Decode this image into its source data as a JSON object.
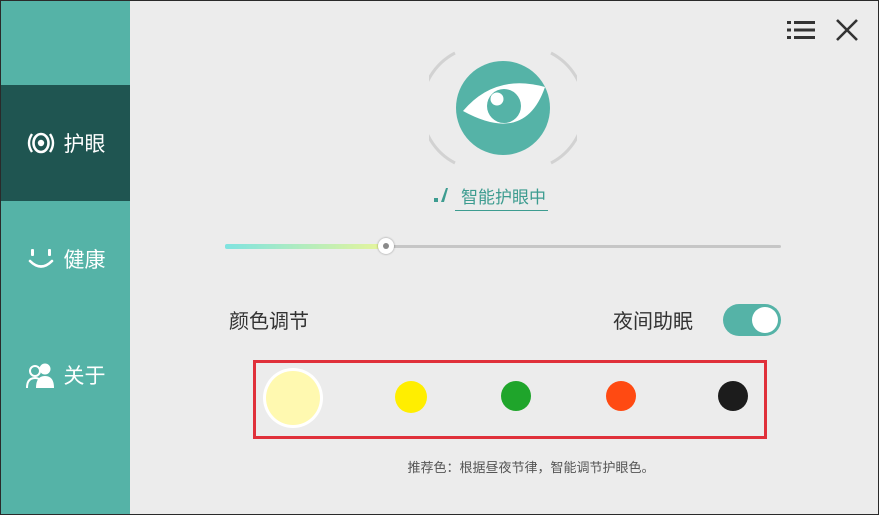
{
  "sidebar": {
    "items": [
      {
        "label": "护眼",
        "icon": "eye-care-icon",
        "active": true
      },
      {
        "label": "健康",
        "icon": "smile-icon",
        "active": false
      },
      {
        "label": "关于",
        "icon": "users-icon",
        "active": false
      }
    ]
  },
  "header": {
    "menu_icon": "list-menu-icon",
    "close_icon": "close-icon"
  },
  "status": {
    "label": "智能护眼中"
  },
  "brightness_slider": {
    "level_percent": 29
  },
  "color_adjust": {
    "title": "颜色调节",
    "swatches": [
      {
        "color": "#fff9b0",
        "selected": true
      },
      {
        "color": "#ffee00",
        "selected": false
      },
      {
        "color": "#1fa52b",
        "selected": false
      },
      {
        "color": "#ff4a12",
        "selected": false
      },
      {
        "color": "#1c1c1c",
        "selected": false
      }
    ],
    "hint": "推荐色：根据昼夜节律，智能调节护眼色。"
  },
  "night_mode": {
    "label": "夜间助眠",
    "enabled": true
  },
  "colors": {
    "accent": "#55b3a7",
    "sidebar_active": "#1f5551",
    "highlight_border": "#e0303a"
  }
}
